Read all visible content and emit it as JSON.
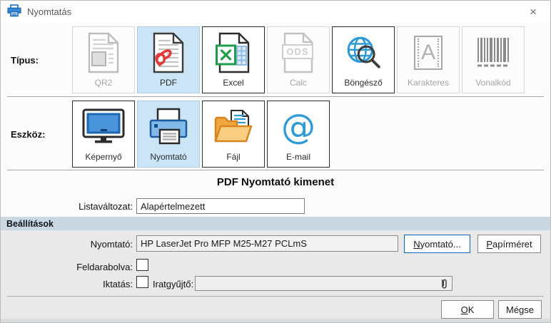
{
  "titlebar": {
    "title": "Nyomtatás",
    "close_glyph": "×"
  },
  "type_row": {
    "label": "Típus:",
    "tiles": [
      {
        "label": "QR2",
        "state": "disabled",
        "icon": "qr2-document-icon"
      },
      {
        "label": "PDF",
        "state": "selected",
        "icon": "pdf-document-icon"
      },
      {
        "label": "Excel",
        "state": "enabled",
        "icon": "excel-document-icon"
      },
      {
        "label": "Calc",
        "state": "disabled",
        "icon": "ods-document-icon"
      },
      {
        "label": "Böngésző",
        "state": "enabled",
        "icon": "browser-globe-icon"
      },
      {
        "label": "Karakteres",
        "state": "disabled",
        "icon": "character-a-icon"
      },
      {
        "label": "Vonalkód",
        "state": "disabled",
        "icon": "barcode-icon"
      }
    ]
  },
  "device_row": {
    "label": "Eszköz:",
    "tiles": [
      {
        "label": "Képernyő",
        "state": "enabled",
        "icon": "monitor-icon"
      },
      {
        "label": "Nyomtató",
        "state": "selected",
        "icon": "printer-icon"
      },
      {
        "label": "Fájl",
        "state": "enabled",
        "icon": "folder-icon"
      },
      {
        "label": "E-mail",
        "state": "enabled",
        "icon": "at-sign-icon"
      }
    ]
  },
  "output_section": {
    "heading": "PDF Nyomtató kimenet",
    "list_variant_label": "Listaváltozat:",
    "list_variant_value": "Alapértelmezett"
  },
  "settings": {
    "section_title": "Beállítások",
    "printer_label": "Nyomtató:",
    "printer_value": "HP LaserJet Pro MFP M25-M27 PCLmS",
    "printer_button": "Nyomtató...",
    "paper_size_button": "Papírméret",
    "split_label": "Feldarabolva:",
    "split_checked": false,
    "filing_label": "Iktatás:",
    "filing_checked": false,
    "binder_label": "Iratgyűjtő:",
    "binder_value": ""
  },
  "footer": {
    "ok_label": "OK",
    "cancel_label": "Mégse"
  },
  "icon_text": {
    "ods": "ODS",
    "character": "A",
    "at": "@"
  },
  "colors": {
    "selection_bg": "#cbe4f6",
    "accent_blue": "#0067c0",
    "section_band": "#c9d8e3",
    "icon_blue": "#2e9bd6",
    "pdf_red": "#e03a3a",
    "excel_green": "#1f9d48",
    "folder_orange": "#d9851f"
  }
}
